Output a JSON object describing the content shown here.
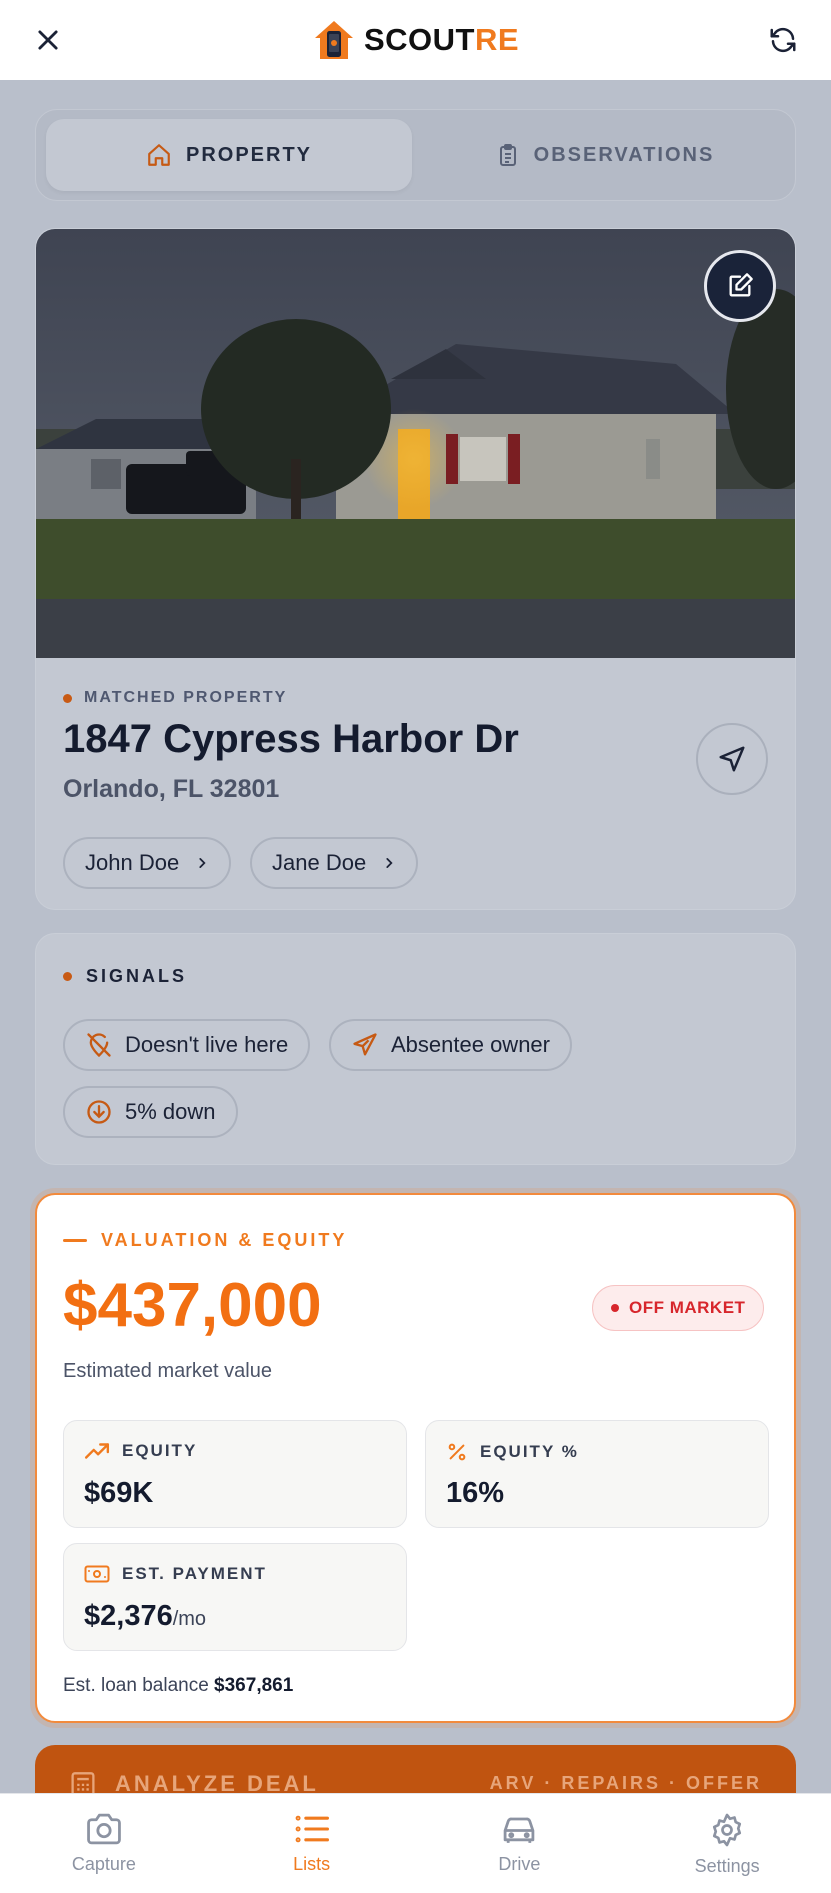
{
  "header": {
    "brand_main": "SCOUT",
    "brand_accent": "RE"
  },
  "tabs": [
    {
      "label": "PROPERTY",
      "active": true
    },
    {
      "label": "OBSERVATIONS",
      "active": false
    }
  ],
  "property": {
    "matched_label": "MATCHED PROPERTY",
    "address": "1847 Cypress Harbor Dr",
    "city": "Orlando, FL 32801",
    "owners": [
      "John Doe",
      "Jane Doe"
    ]
  },
  "signals": {
    "title": "SIGNALS",
    "items": [
      {
        "label": "Doesn't live here",
        "icon": "location-off-icon"
      },
      {
        "label": "Absentee owner",
        "icon": "plane-icon"
      },
      {
        "label": "5% down",
        "icon": "arrow-down-circle-icon"
      }
    ]
  },
  "valuation": {
    "title": "VALUATION & EQUITY",
    "price": "$437,000",
    "price_sub": "Estimated market value",
    "status": "OFF MARKET",
    "equity_label": "EQUITY",
    "equity_value": "$69K",
    "equity_pct_label": "EQUITY %",
    "equity_pct_value": "16%",
    "payment_label": "EST. PAYMENT",
    "payment_value": "$2,376",
    "payment_unit": "/mo",
    "loan_label": "Est. loan balance",
    "loan_value": "$367,861"
  },
  "analyze": {
    "label": "ANALYZE DEAL",
    "right": "ARV · REPAIRS · OFFER"
  },
  "bottom_nav": [
    {
      "label": "Capture",
      "icon": "camera-icon",
      "active": false
    },
    {
      "label": "Lists",
      "icon": "list-icon",
      "active": true
    },
    {
      "label": "Drive",
      "icon": "car-icon",
      "active": false
    },
    {
      "label": "Settings",
      "icon": "gear-icon",
      "active": false
    }
  ],
  "colors": {
    "accent": "#f07a1e",
    "navy": "#1a2339",
    "danger": "#d7262c"
  }
}
